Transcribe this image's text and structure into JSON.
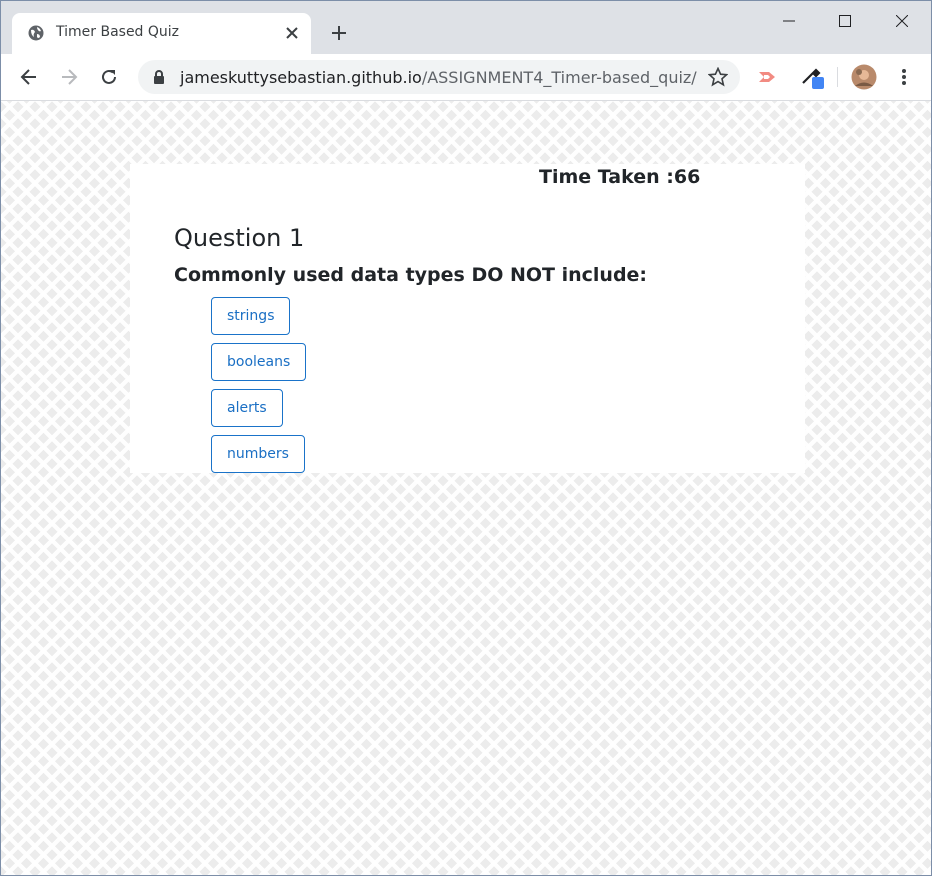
{
  "browser": {
    "tab_title": "Timer Based Quiz",
    "url_host": "jameskuttysebastian.github.io",
    "url_path": "/ASSIGNMENT4_Timer-based_quiz/"
  },
  "quiz": {
    "timer_label": "Time Taken :66",
    "question_title": "Question 1",
    "question_text": "Commonly used data types DO NOT include:",
    "answers": [
      "strings",
      "booleans",
      "alerts",
      "numbers"
    ]
  },
  "colors": {
    "tabstrip": "#dee1e6",
    "answer_border": "#1a73c9",
    "answer_text": "#1a6fc4"
  }
}
